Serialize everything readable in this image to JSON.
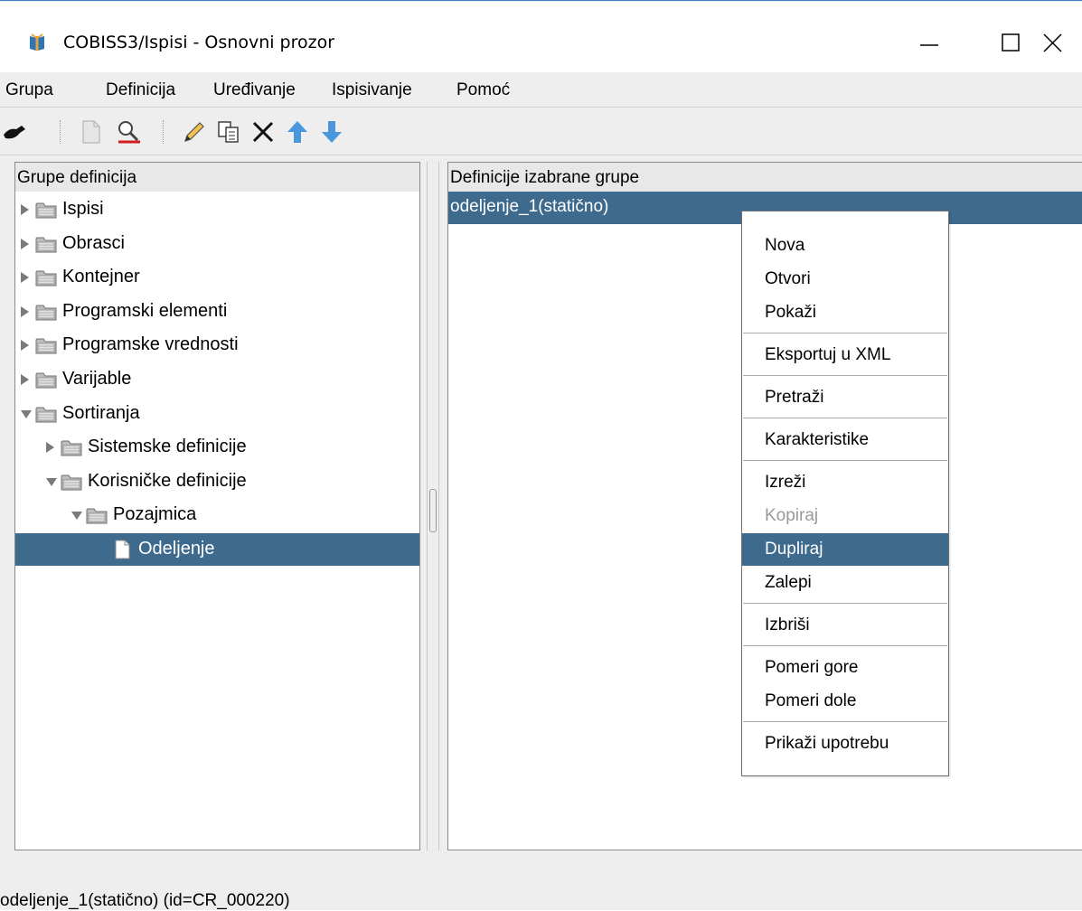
{
  "window": {
    "title": "COBISS3/Ispisi - Osnovni prozor",
    "controls": {
      "minimize": "minimize",
      "maximize": "maximize",
      "close": "close"
    }
  },
  "menubar": {
    "items": [
      "Grupa",
      "Definicija",
      "Uređivanje",
      "Ispisivanje",
      "Pomoć"
    ]
  },
  "toolbar": {
    "buttons": [
      "exit-icon",
      "new-icon",
      "search-icon",
      "edit-icon",
      "copy-icon",
      "delete-icon",
      "move-up-icon",
      "move-down-icon"
    ]
  },
  "left_panel": {
    "header": "Grupe definicija",
    "tree": [
      {
        "label": "Ispisi",
        "level": 0,
        "expanded": false,
        "type": "folder"
      },
      {
        "label": "Obrasci",
        "level": 0,
        "expanded": false,
        "type": "folder"
      },
      {
        "label": "Kontejner",
        "level": 0,
        "expanded": false,
        "type": "folder"
      },
      {
        "label": "Programski elementi",
        "level": 0,
        "expanded": false,
        "type": "folder"
      },
      {
        "label": "Programske vrednosti",
        "level": 0,
        "expanded": false,
        "type": "folder"
      },
      {
        "label": "Varijable",
        "level": 0,
        "expanded": false,
        "type": "folder"
      },
      {
        "label": "Sortiranja",
        "level": 0,
        "expanded": true,
        "type": "folder"
      },
      {
        "label": "Sistemske definicije",
        "level": 1,
        "expanded": false,
        "type": "folder"
      },
      {
        "label": "Korisničke definicije",
        "level": 1,
        "expanded": true,
        "type": "folder"
      },
      {
        "label": "Pozajmica",
        "level": 2,
        "expanded": true,
        "type": "folder"
      },
      {
        "label": "Odeljenje",
        "level": 3,
        "expanded": false,
        "type": "document",
        "selected": true
      }
    ]
  },
  "right_panel": {
    "header": "Definicije izabrane grupe",
    "items": [
      "odeljenje_1(statično)"
    ]
  },
  "context_menu": {
    "items": [
      {
        "label": "Nova",
        "state": "normal"
      },
      {
        "label": "Otvori",
        "state": "normal"
      },
      {
        "label": "Pokaži",
        "state": "normal"
      },
      {
        "label": "Eksportuj u XML",
        "state": "normal"
      },
      {
        "label": "Pretraži",
        "state": "normal"
      },
      {
        "label": "Karakteristike",
        "state": "normal"
      },
      {
        "label": "Izreži",
        "state": "normal"
      },
      {
        "label": "Kopiraj",
        "state": "disabled"
      },
      {
        "label": "Dupliraj",
        "state": "highlighted"
      },
      {
        "label": "Zalepi",
        "state": "normal"
      },
      {
        "label": "Izbriši",
        "state": "normal"
      },
      {
        "label": "Pomeri gore",
        "state": "normal"
      },
      {
        "label": "Pomeri dole",
        "state": "normal"
      },
      {
        "label": "Prikaži upotrebu",
        "state": "normal"
      }
    ]
  },
  "statusbar": {
    "text": "odeljenje_1(statično) (id=CR_000220)"
  },
  "colors": {
    "selection": "#3e6a8e",
    "window_bg": "#eeeeee",
    "title_accent": "#3b7fc4"
  }
}
